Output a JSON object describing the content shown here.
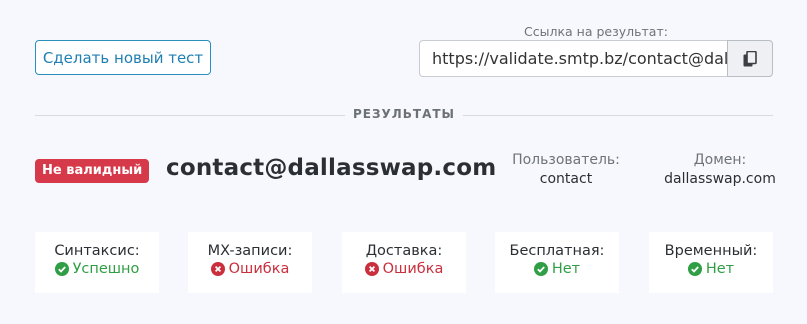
{
  "toolbar": {
    "new_test_label": "Сделать новый тест"
  },
  "result_link": {
    "caption": "Ссылка на результат:",
    "value": "https://validate.smtp.bz/contact@dallasswap.com"
  },
  "section_title": "РЕЗУЛЬТАТЫ",
  "result": {
    "status_badge": "Не валидный",
    "email": "contact@dallasswap.com",
    "user_label": "Пользователь:",
    "user_value": "contact",
    "domain_label": "Домен:",
    "domain_value": "dallasswap.com"
  },
  "checks": [
    {
      "label": "Синтаксис:",
      "status": "Успешно",
      "state": "ok"
    },
    {
      "label": "MX-записи:",
      "status": "Ошибка",
      "state": "error"
    },
    {
      "label": "Доставка:",
      "status": "Ошибка",
      "state": "error"
    },
    {
      "label": "Бесплатная:",
      "status": "Нет",
      "state": "ok"
    },
    {
      "label": "Временный:",
      "status": "Нет",
      "state": "ok"
    }
  ],
  "colors": {
    "accent": "#1f7fb2",
    "ok": "#2f9e44",
    "error": "#c92f3d",
    "badge": "#d63a4a"
  },
  "icons": {
    "copy": "copy-icon",
    "ok": "check-circle-icon",
    "error": "x-circle-icon"
  }
}
